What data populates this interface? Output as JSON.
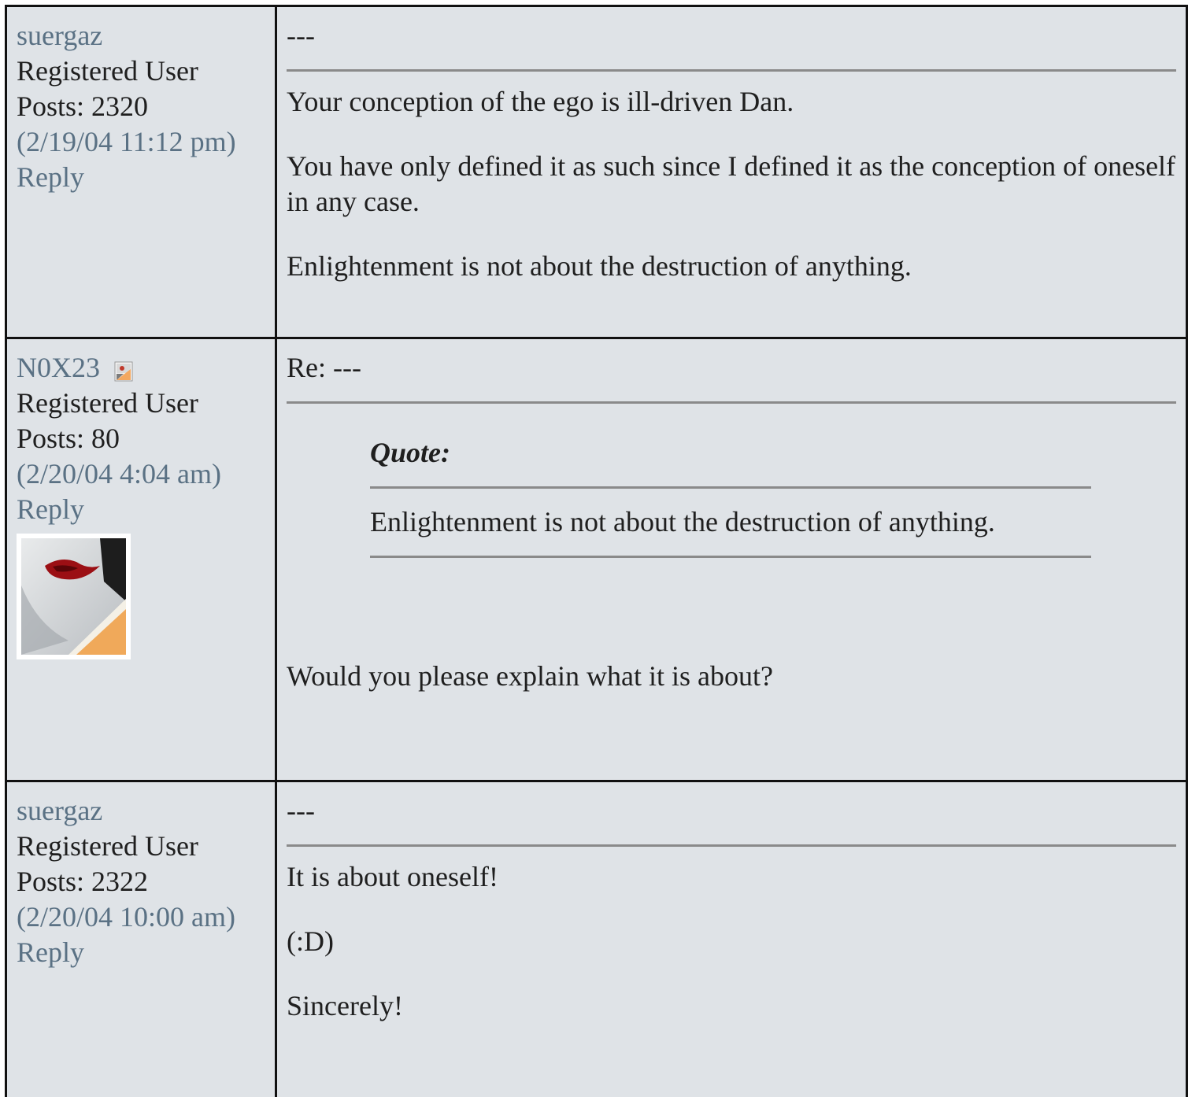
{
  "posts": [
    {
      "username": "suergaz",
      "role": "Registered User",
      "posts_count": "Posts: 2320",
      "timestamp": "(2/19/04 11:12 pm)",
      "reply_label": "Reply",
      "subject": "---",
      "paragraphs": [
        "Your conception of the ego is ill-driven Dan.",
        "You have only defined it as such since I defined it as the conception of oneself in any case.",
        "Enlightenment is not about the destruction of anything."
      ]
    },
    {
      "username": "N0X23",
      "user_icon": "profile-badge-icon",
      "role": "Registered User",
      "posts_count": "Posts: 80",
      "timestamp": "(2/20/04 4:04 am)",
      "reply_label": "Reply",
      "subject": "Re: ---",
      "quote": {
        "label": "Quote:",
        "text": "Enlightenment is not about the destruction of anything."
      },
      "paragraphs": [
        "Would you please explain what it is about?"
      ]
    },
    {
      "username": "suergaz",
      "role": "Registered User",
      "posts_count": "Posts: 2322",
      "timestamp": "(2/20/04 10:00 am)",
      "reply_label": "Reply",
      "subject": "---",
      "paragraphs": [
        "It is about oneself!",
        "(:D)",
        "Sincerely!"
      ]
    }
  ]
}
